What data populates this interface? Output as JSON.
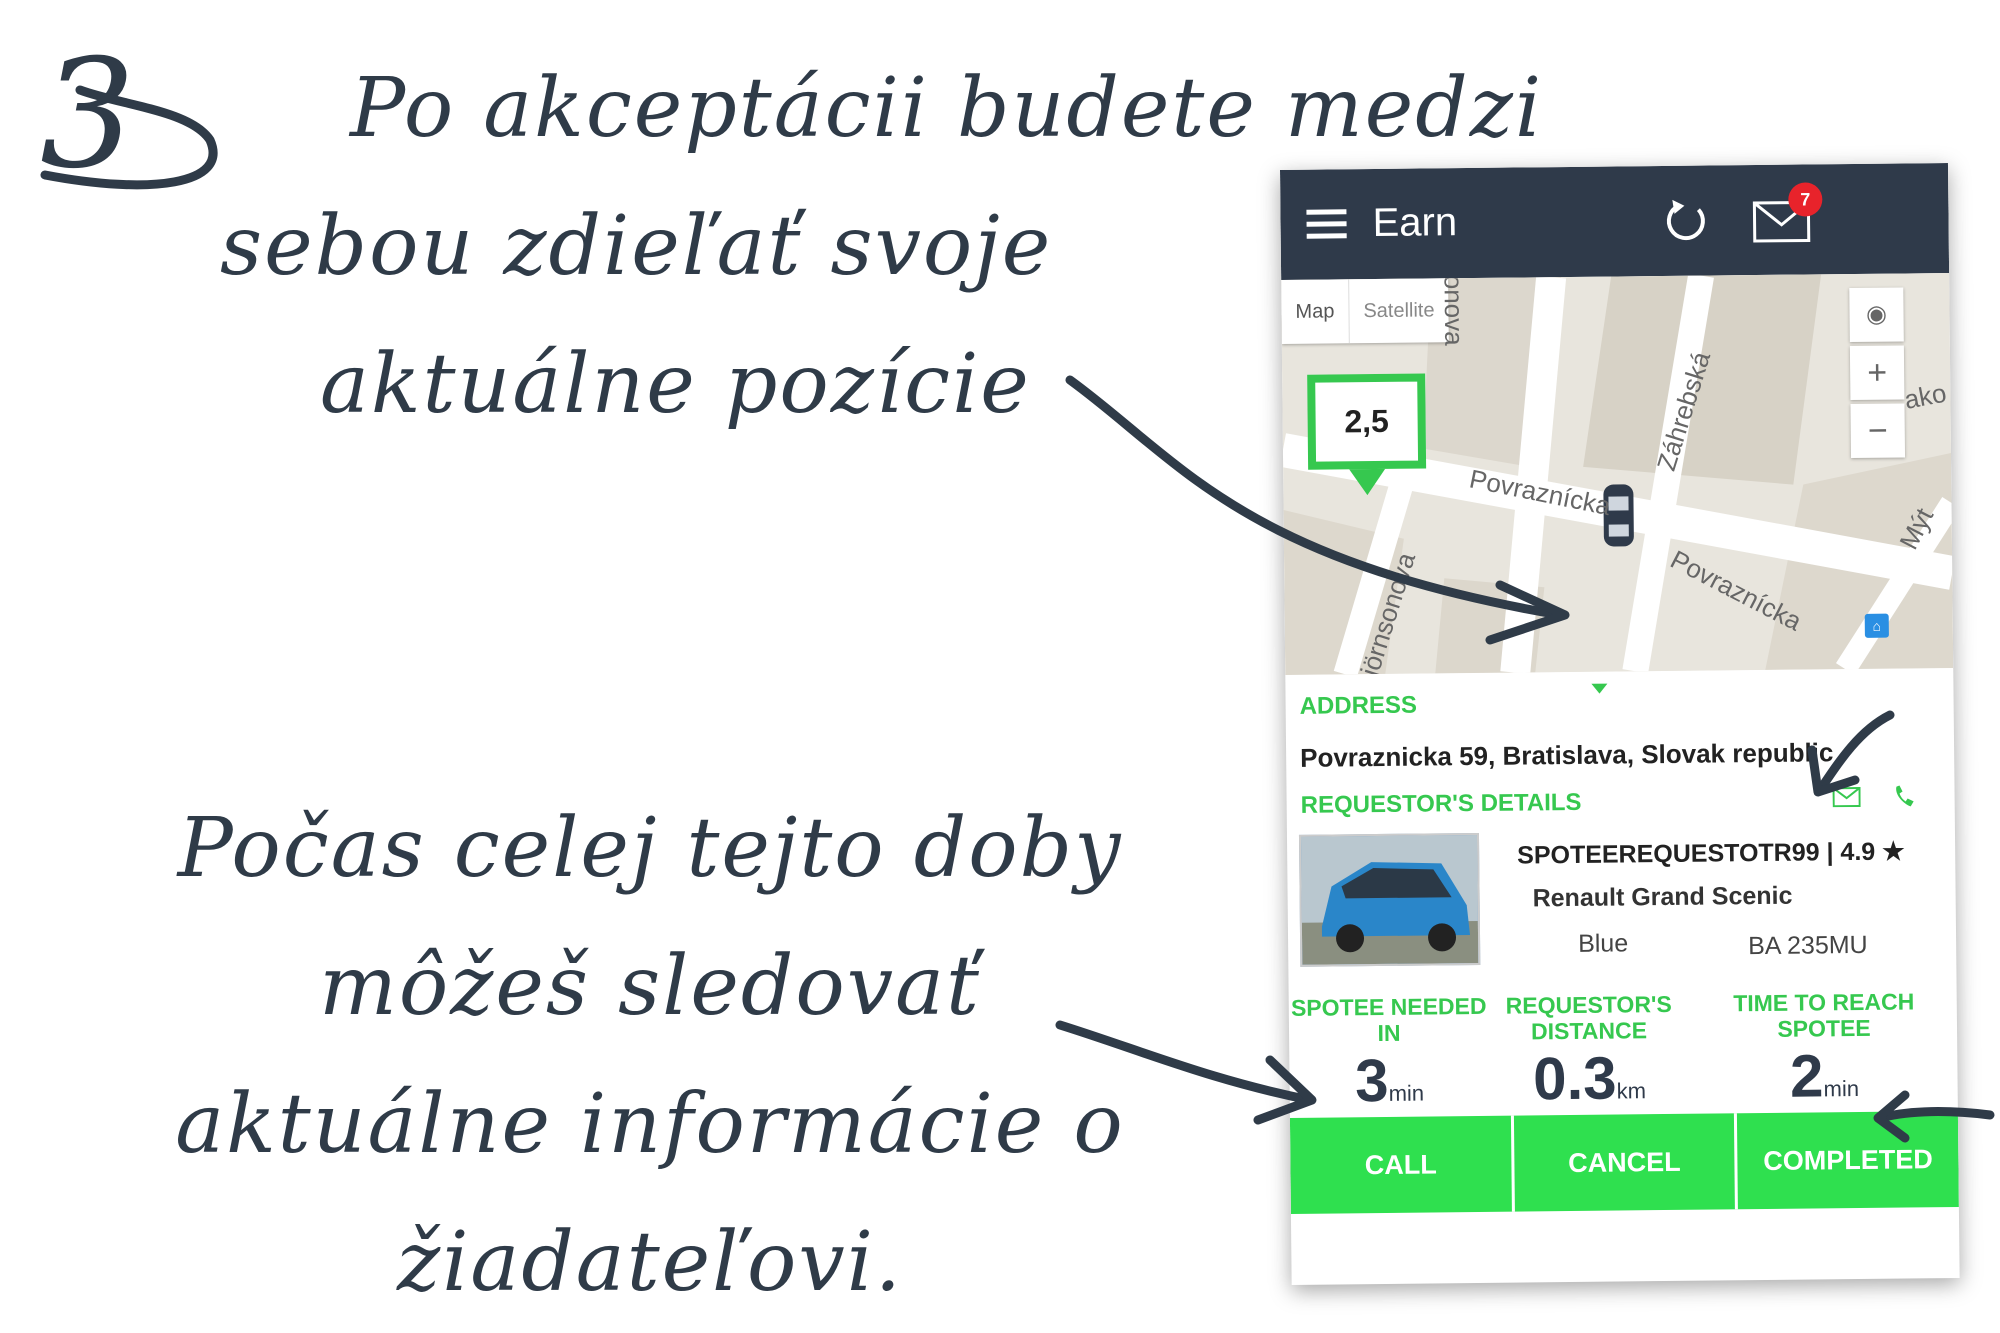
{
  "step_number": "3",
  "top_caption": {
    "line1": "Po akceptácii budete medzi",
    "line2": "sebou zdieľať svoje",
    "line3": "aktuálne pozície"
  },
  "bottom_caption": {
    "line1": "Počas celej tejto doby",
    "line2": "môžeš sledovať",
    "line3": "aktuálne informácie o",
    "line4": "žiadateľovi."
  },
  "app": {
    "header": {
      "title": "Earn",
      "badge_count": "7",
      "menu_icon": "hamburger-icon",
      "refresh_icon": "refresh-icon",
      "mail_icon": "envelope-icon"
    },
    "map": {
      "type_map": "Map",
      "type_satellite": "Satellite",
      "zoom_in": "+",
      "zoom_out": "−",
      "price_pin": "2,5",
      "streets": {
        "s1": "Povraznícka",
        "s2": "Povraznícka",
        "s3": "Záhrebská",
        "s4": "sonova",
        "s5": "jörnsonova",
        "s6": "Mýt",
        "s7": "ako"
      }
    },
    "address": {
      "label": "ADDRESS",
      "value": "Povraznicka 59, Bratislava, Slovak republic"
    },
    "requestor": {
      "label": "REQUESTOR'S DETAILS",
      "name_rating": "SPOTEEREQUESTOTR99 | 4.9 ★",
      "car_model": "Renault Grand Scenic",
      "car_color": "Blue",
      "plate": "BA 235MU"
    },
    "stats": {
      "needed": {
        "label": "SPOTEE NEEDED IN",
        "value": "3",
        "unit": "min"
      },
      "distance": {
        "label": "REQUESTOR'S DISTANCE",
        "value": "0.3",
        "unit": "km"
      },
      "reach": {
        "label": "TIME TO REACH SPOTEE",
        "value": "2",
        "unit": "min"
      }
    },
    "actions": {
      "call": "CALL",
      "cancel": "CANCEL",
      "completed": "COMPLETED"
    }
  },
  "colors": {
    "accent_green": "#36c84f",
    "header_dark": "#2f3a4a",
    "badge_red": "#e8232b",
    "ink": "#2f3b48"
  }
}
